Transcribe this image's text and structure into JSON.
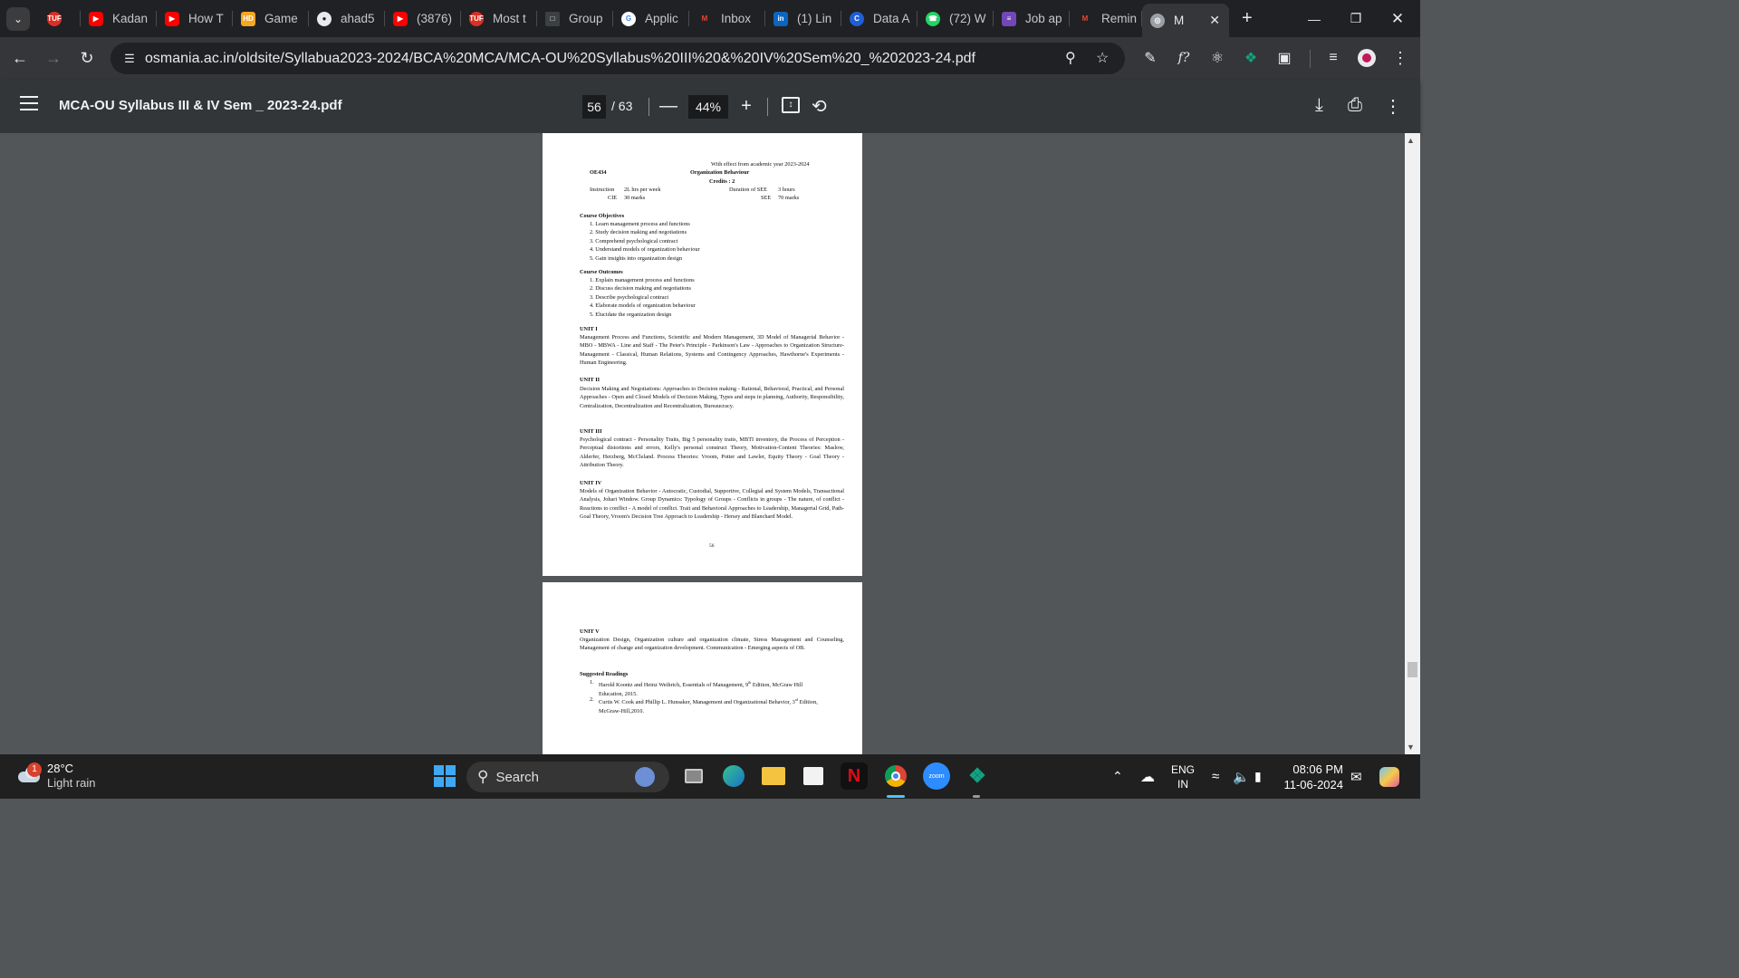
{
  "browser": {
    "tabs": [
      {
        "title": "",
        "icon": "tuf-icon"
      },
      {
        "title": "Kadan",
        "icon": "youtube-icon"
      },
      {
        "title": "How T",
        "icon": "youtube-icon"
      },
      {
        "title": "Game",
        "icon": "hd-icon"
      },
      {
        "title": "ahad5",
        "icon": "github-icon"
      },
      {
        "title": "(3876)",
        "icon": "youtube-icon"
      },
      {
        "title": "Most t",
        "icon": "tuf-icon"
      },
      {
        "title": "Group",
        "icon": "doc-icon"
      },
      {
        "title": "Applic",
        "icon": "google-icon"
      },
      {
        "title": "Inbox",
        "icon": "gmail-icon"
      },
      {
        "title": "(1) Lin",
        "icon": "linkedin-icon"
      },
      {
        "title": "Data A",
        "icon": "c-icon"
      },
      {
        "title": "(72) W",
        "icon": "whatsapp-icon"
      },
      {
        "title": "Job ap",
        "icon": "forms-icon"
      },
      {
        "title": "Remin",
        "icon": "gmail-icon"
      },
      {
        "title": "M",
        "icon": "globe-icon"
      }
    ],
    "fav_labels": {
      "tuf": "TUF",
      "hd": "HD",
      "c": "C",
      "in": "in"
    },
    "url": "osmania.ac.in/oldsite/Syllabua2023-2024/BCA%20MCA/MCA-OU%20Syllabus%20III%20&%20IV%20Sem%20_%202023-24.pdf"
  },
  "pdf": {
    "title": "MCA-OU Syllabus III & IV Sem _ 2023-24.pdf",
    "page_current": "56",
    "page_total": "/ 63",
    "zoom": "44%"
  },
  "page56": {
    "effect": "With effect from academic year 2023-2024",
    "code": "OE434",
    "course": "Organization Behaviour",
    "credits": "Credits : 2",
    "instruction_label": "Instruction",
    "instruction_value": "2L hrs per week",
    "duration_label": "Duration of SEE",
    "duration_value": "3 hours",
    "cie_label": "CIE",
    "cie_value": "30 marks",
    "see_label": "SEE",
    "see_value": "70 marks",
    "objectives_heading": "Course Objectives",
    "objectives": [
      "1.  Learn management process and functions",
      "2.  Study decision making and negotiations",
      "3.  Comprehend psychological contract",
      "4.  Understand models of organization behaviour",
      "5.  Gain insights into organization design"
    ],
    "outcomes_heading": "Course Outcomes",
    "outcomes": [
      "1.  Explain management process and functions",
      "2.  Discuss decision making and negotiations",
      "3.  Describe psychological contract",
      "4.  Elaborate models of organization behaviour",
      "5.  Elucidate the organization design"
    ],
    "unit1_heading": "UNIT I",
    "unit1_text": "Management Process and Functions, Scientific and Modern Management, 3D Model of Managerial Behavior - MBO - MBWA - Line and Staff - The Peter's Principle - Parkinson's Law - Approaches to Organization Structure-Management - Classical, Human Relations, Systems and Contingency Approaches, Hawthorne's Experiments - Human Engineering.",
    "unit2_heading": "UNIT II",
    "unit2_text": "Decision Making and Negotiations: Approaches to Decision making - Rational, Behavioral, Practical, and Personal Approaches - Open and Closed Models of Decision Making, Types and steps in planning, Authority, Responsibility, Centralization, Decentralization and Recentralization, Bureaucracy.",
    "unit3_heading": "UNIT III",
    "unit3_text": "Psychological contract - Personality Traits, Big 5 personality traits, MBTI inventory, the Process of Perception - Perceptual distortions and errors, Kelly's personal construct Theory, Motivation-Content Theories: Maslow, Alderfer, Herzberg, McCleland. Process Theories: Vroom, Potter and Lawler, Equity Theory - Goal Theory - Attribution Theory.",
    "unit4_heading": "UNIT IV",
    "unit4_text": "Models of Organization Behavior - Autocratic, Custodial, Supportive, Collegial and System Models, Transactional Analysis, Johari Window. Group Dynamics: Typology of Groups - Conflicts in groups - The nature, of conflict - Reactions to conflict - A model of conflict. Trait and Behavioral Approaches to Leadership, Managerial Grid, Path-Goal Theory, Vroom's Decision Tree Approach to Leadership - Hersey and Blanchard Model.",
    "page_number": "56"
  },
  "page57": {
    "unit5_heading": "UNIT V",
    "unit5_text": "Organization Design, Organization culture and organization climate, Stress Management and Counseling, Management of change and organization development. Communication - Emerging aspects of OB.",
    "readings_heading": "Suggested Readings",
    "reading1_num": "1.",
    "reading1_pre": "Harold Koontz and Heinz Weihrich, Essentials of Management, 9",
    "reading1_sup": "th",
    "reading1_post": " Edition, McGraw Hill Education, 2015.",
    "reading2_num": "2.",
    "reading2_pre": "Curtis W. Cook and Phillip L. Hunsaker, Management and Organizational Behavior, 3",
    "reading2_sup": "rd",
    "reading2_post": " Edition, McGraw-Hill,2010."
  },
  "taskbar": {
    "weather_badge": "1",
    "temperature": "28°C",
    "condition": "Light rain",
    "search_label": "Search",
    "lang_top": "ENG",
    "lang_bottom": "IN",
    "time": "08:06 PM",
    "date": "11-06-2024",
    "zoom_label": "zoom"
  }
}
